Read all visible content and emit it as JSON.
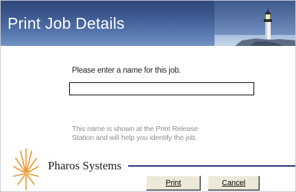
{
  "dialog": {
    "title": "Print Job Details",
    "prompt": "Please enter a name for this job.",
    "job_name_value": "",
    "info_line_1": "This name is shown at the Print Release",
    "info_line_2": "Station and will help you identify the job."
  },
  "branding": {
    "company": "Pharos Systems",
    "logo_icon": "sunburst-logo-icon",
    "header_image": "lighthouse-icon",
    "accent_color": "#1f2f72",
    "header_color": "#3e5a91",
    "logo_color": "#e8922a"
  },
  "buttons": {
    "print_label": "Print",
    "cancel_label": "Cancel"
  }
}
